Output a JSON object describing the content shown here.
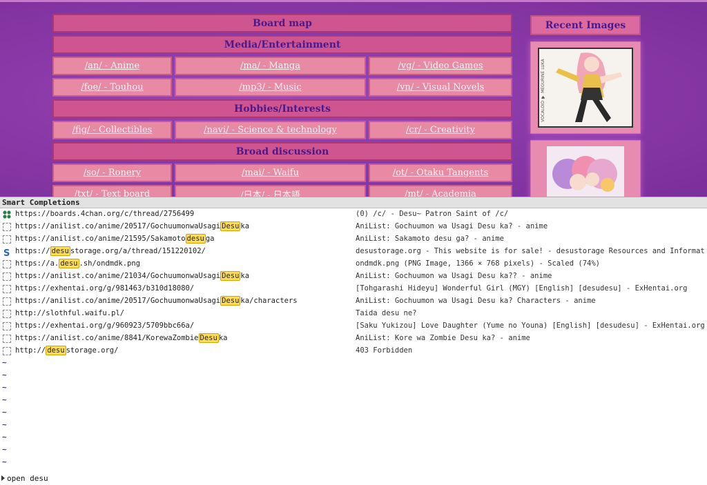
{
  "board": {
    "title": "Board map",
    "categories": [
      {
        "name": "Media/Entertainment",
        "rows": [
          [
            "/an/ - Anime",
            "/ma/ - Manga",
            "/vg/ - Video Games"
          ],
          [
            "/foe/ - Touhou",
            "/mp3/ - Music",
            "/vn/ - Visual Novels"
          ]
        ]
      },
      {
        "name": "Hobbies/Interests",
        "rows": [
          [
            "/fig/ - Collectibles",
            "/navi/ - Science & technology",
            "/cr/ - Creativity"
          ]
        ]
      },
      {
        "name": "Broad discussion",
        "rows": [
          [
            "/so/ - Ronery",
            "/mai/ - Waifu",
            "/ot/ - Otaku Tangents"
          ],
          [
            "/txt/ - Text board",
            "/日本/ - 日本語",
            "/mt/ - Academia"
          ]
        ]
      }
    ]
  },
  "recent": {
    "title": "Recent Images",
    "thumb1_caption": "VOCALOID ♥ MEGURINE LUKA"
  },
  "completions": {
    "header": "Smart Completions",
    "items": [
      {
        "icon": "4chan-clover-icon",
        "url": [
          "https://boards.4chan.org/c/thread/2756499"
        ],
        "title": "(0) /c/ - Desu~ Patron Saint of /c/"
      },
      {
        "icon": "blank-favicon-icon",
        "url": [
          "https://anilist.co/anime/20517/GochuumonwaUsagi",
          "Desu",
          "ka"
        ],
        "title": "AniList: Gochuumon wa Usagi Desu ka? - anime"
      },
      {
        "icon": "blank-favicon-icon",
        "url": [
          "https://anilist.co/anime/21595/Sakamoto",
          "desu",
          "ga"
        ],
        "title": "AniList: Sakamoto desu ga? - anime"
      },
      {
        "icon": "desustorage-s-icon",
        "url": [
          "https://",
          "desu",
          "storage.org/a/thread/151220102/"
        ],
        "title": "desustorage.org - This website is for sale! - desustorage Resources and Information."
      },
      {
        "icon": "blank-favicon-icon",
        "url": [
          "https://a.",
          "desu",
          ".sh/ondmdk.png"
        ],
        "title": "ondmdk.png (PNG Image, 1366 × 768 pixels) - Scaled (74%)"
      },
      {
        "icon": "blank-favicon-icon",
        "url": [
          "https://anilist.co/anime/21034/GochuumonwaUsagi",
          "Desu",
          "ka"
        ],
        "title": "AniList: Gochuumon wa Usagi Desu ka?? - anime"
      },
      {
        "icon": "blank-favicon-icon",
        "url": [
          "https://exhentai.org/g/981463/b310d18080/"
        ],
        "title": "[Tohgarashi Hideyu] Wonderful Girl (MGY) [English] [desudesu] - ExHentai.org"
      },
      {
        "icon": "blank-favicon-icon",
        "url": [
          "https://anilist.co/anime/20517/GochuumonwaUsagi",
          "Desu",
          "ka/characters"
        ],
        "title": "AniList: Gochuumon wa Usagi Desu ka? Characters - anime"
      },
      {
        "icon": "blank-favicon-icon",
        "url": [
          "http://slothful.waifu.pl/"
        ],
        "title": "Taida desu ne?"
      },
      {
        "icon": "blank-favicon-icon",
        "url": [
          "https://exhentai.org/g/960923/5709bbc66a/"
        ],
        "title": "[Saku Yukizou] Love Daughter (Yume no Youna) [English] [desudesu] - ExHentai.org"
      },
      {
        "icon": "blank-favicon-icon",
        "url": [
          "https://anilist.co/anime/8841/KorewaZombie",
          "Desu",
          "ka"
        ],
        "title": "AniList: Kore wa Zombie Desu ka? - anime"
      },
      {
        "icon": "blank-favicon-icon",
        "url": [
          "http://",
          "desu",
          "storage.org/"
        ],
        "title": "403 Forbidden"
      }
    ]
  },
  "tilde": "~",
  "commandline": {
    "text": "open desu"
  },
  "colors": {
    "site_bg": "#8a3aa8",
    "header_pink": "#cf5591",
    "cell_pink": "#e88aa4",
    "title_purple": "#4a1a8c",
    "highlight": "#ffdd55"
  }
}
